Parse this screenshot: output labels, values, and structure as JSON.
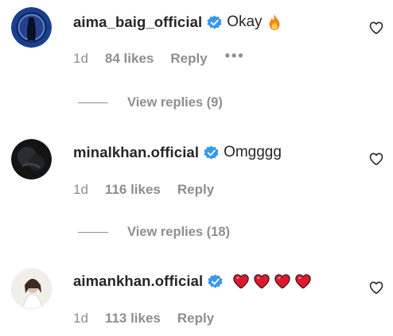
{
  "comments": [
    {
      "username": "aima_baig_official",
      "text": "Okay",
      "emoji": "fire-emoji",
      "time": "1d",
      "likes": "84 likes",
      "reply_label": "Reply",
      "more_label": "•••",
      "view_replies": "View replies (9)"
    },
    {
      "username": "minalkhan.official",
      "text": "Omgggg",
      "time": "1d",
      "likes": "116 likes",
      "reply_label": "Reply",
      "view_replies": "View replies (18)"
    },
    {
      "username": "aimankhan.official",
      "text": "",
      "emoji": "red-heart-emoji x4",
      "time": "1d",
      "likes": "113 likes",
      "reply_label": "Reply"
    }
  ],
  "colors": {
    "verified": "#3897f0",
    "secondary_text": "#8e8e8e",
    "primary_text": "#262626",
    "heart_red": "#e0182d"
  }
}
